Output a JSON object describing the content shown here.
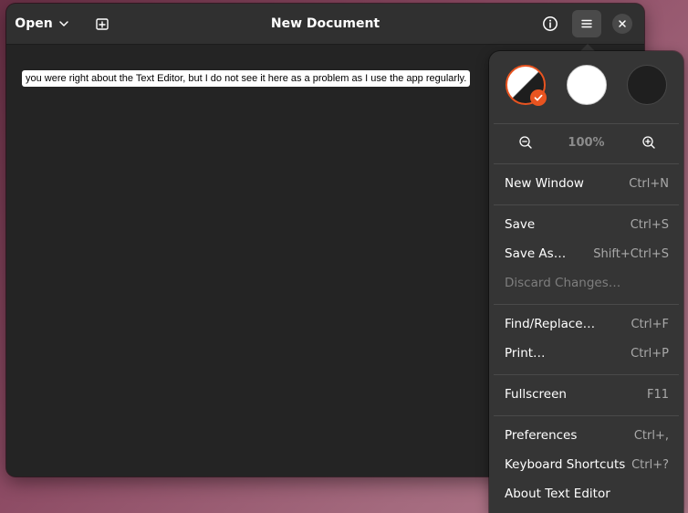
{
  "header": {
    "open_label": "Open",
    "title": "New Document"
  },
  "editor": {
    "selected_text": "you were right about the Text Editor, but I do not see it here as a problem as I use the app regularly."
  },
  "menu": {
    "styles": [
      {
        "name": "follow-system",
        "selected": true
      },
      {
        "name": "light",
        "selected": false
      },
      {
        "name": "dark",
        "selected": false
      }
    ],
    "zoom_level": "100%",
    "items": [
      {
        "label": "New Window",
        "accel": "Ctrl+N"
      },
      {
        "label": "Save",
        "accel": "Ctrl+S"
      },
      {
        "label": "Save As…",
        "accel": "Shift+Ctrl+S"
      },
      {
        "label": "Discard Changes…",
        "accel": ""
      },
      {
        "label": "Find/Replace…",
        "accel": "Ctrl+F"
      },
      {
        "label": "Print…",
        "accel": "Ctrl+P"
      },
      {
        "label": "Fullscreen",
        "accel": "F11"
      },
      {
        "label": "Preferences",
        "accel": "Ctrl+,"
      },
      {
        "label": "Keyboard Shortcuts",
        "accel": "Ctrl+?"
      },
      {
        "label": "About Text Editor",
        "accel": ""
      }
    ]
  },
  "colors": {
    "accent": "#e95420",
    "window_bg": "#242424",
    "headerbar_bg": "#303030",
    "popover_bg": "#353535"
  },
  "icons": [
    "chevron-down-icon",
    "new-tab-icon",
    "info-icon",
    "hamburger-menu-icon",
    "close-icon",
    "checkmark-icon",
    "zoom-out-icon",
    "zoom-in-icon"
  ]
}
